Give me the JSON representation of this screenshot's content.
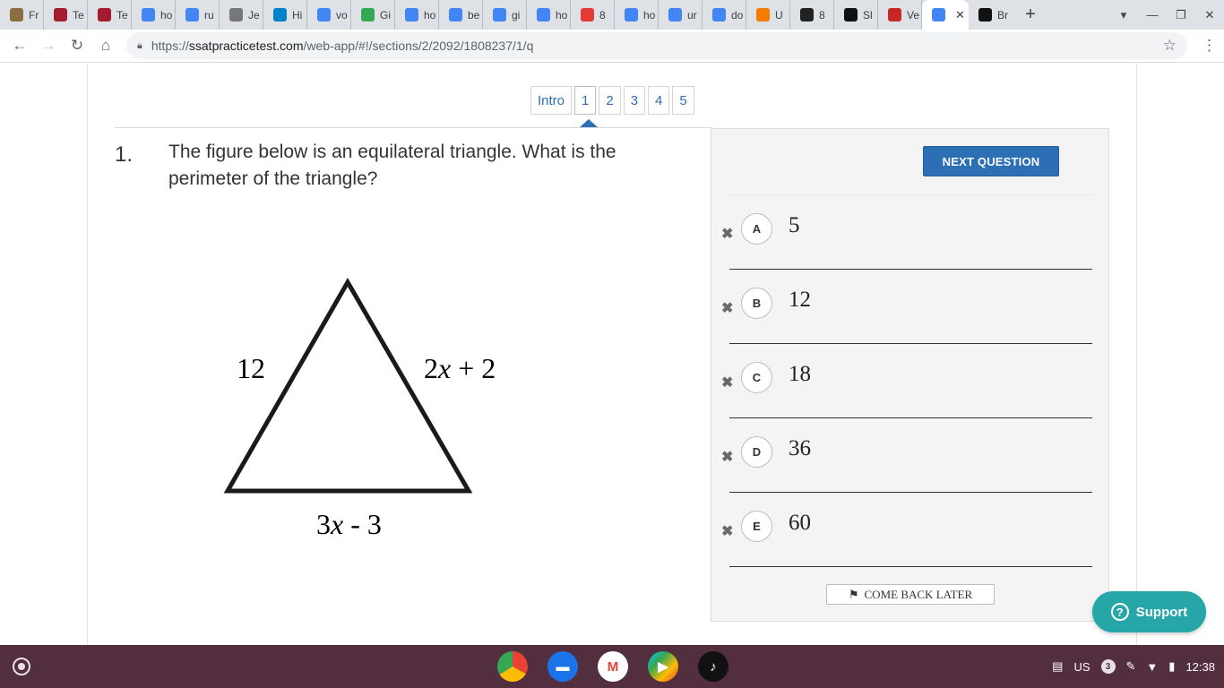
{
  "browser": {
    "tabs": [
      {
        "label": "Fr",
        "icon": "document-icon",
        "color": "#8c6d3f"
      },
      {
        "label": "Te",
        "icon": "harvard-shield-icon",
        "color": "#a51c30"
      },
      {
        "label": "Te",
        "icon": "harvard-shield-icon",
        "color": "#a51c30"
      },
      {
        "label": "ho",
        "icon": "google-icon",
        "color": "#4285f4"
      },
      {
        "label": "ru",
        "icon": "google-icon",
        "color": "#4285f4"
      },
      {
        "label": "Je",
        "icon": "volleyball-icon",
        "color": "#777777"
      },
      {
        "label": "Hi",
        "icon": "olympic-rings-icon",
        "color": "#0081c8"
      },
      {
        "label": "vo",
        "icon": "google-icon",
        "color": "#4285f4"
      },
      {
        "label": "Gi",
        "icon": "heart-icon",
        "color": "#34a853"
      },
      {
        "label": "ho",
        "icon": "google-icon",
        "color": "#4285f4"
      },
      {
        "label": "be",
        "icon": "google-icon",
        "color": "#4285f4"
      },
      {
        "label": "gi",
        "icon": "google-icon",
        "color": "#4285f4"
      },
      {
        "label": "ho",
        "icon": "google-icon",
        "color": "#4285f4"
      },
      {
        "label": "8",
        "icon": "red-square-icon",
        "color": "#e53935"
      },
      {
        "label": "ho",
        "icon": "google-icon",
        "color": "#4285f4"
      },
      {
        "label": "ur",
        "icon": "google-icon",
        "color": "#4285f4"
      },
      {
        "label": "do",
        "icon": "google-icon",
        "color": "#4285f4"
      },
      {
        "label": "U",
        "icon": "u-logo-icon",
        "color": "#f57c00"
      },
      {
        "label": "8",
        "icon": "peacock-icon",
        "color": "#222222"
      },
      {
        "label": "Sl",
        "icon": "info-circle-icon",
        "color": "#111111"
      },
      {
        "label": "Ve",
        "icon": "chart-line-icon",
        "color": "#c62828"
      }
    ],
    "active_tab": {
      "icon": "eye-icon",
      "color": "#4285f4"
    },
    "after_active_tab": {
      "label": "Br",
      "icon": "b-logo-icon",
      "color": "#111111"
    },
    "url_host": "ssatpracticetest.com",
    "url_prefix": "https://",
    "url_path": "/web-app/#!/sections/2/2092/1808237/1/q"
  },
  "pager": {
    "items": [
      "Intro",
      "1",
      "2",
      "3",
      "4",
      "5"
    ],
    "current": "1"
  },
  "question": {
    "number": "1.",
    "text": "The figure below is an equilateral triangle. What is the perimeter of the triangle?",
    "figure": {
      "left_side": "12",
      "right_side": {
        "var": "x",
        "before": "2",
        "after": " + 2"
      },
      "bottom_side": {
        "var": "x",
        "before": "3",
        "after": " - 3"
      }
    }
  },
  "answers": {
    "next_label": "NEXT QUESTION",
    "choices": [
      {
        "letter": "A",
        "value": "5"
      },
      {
        "letter": "B",
        "value": "12"
      },
      {
        "letter": "C",
        "value": "18"
      },
      {
        "letter": "D",
        "value": "36"
      },
      {
        "letter": "E",
        "value": "60"
      }
    ],
    "come_back_label": "COME BACK LATER"
  },
  "support": {
    "label": "Support"
  },
  "shelf": {
    "apps": [
      {
        "name": "chrome-icon"
      },
      {
        "name": "files-icon"
      },
      {
        "name": "gmail-icon"
      },
      {
        "name": "play-store-icon"
      },
      {
        "name": "tiktok-icon"
      }
    ],
    "keyboard": "US",
    "notifications": "3",
    "time": "12:38"
  },
  "colors": {
    "accent": "#2c6fb5",
    "panel": "#f4f4f4",
    "support": "#27a6a8",
    "shelf": "#532e3e"
  }
}
